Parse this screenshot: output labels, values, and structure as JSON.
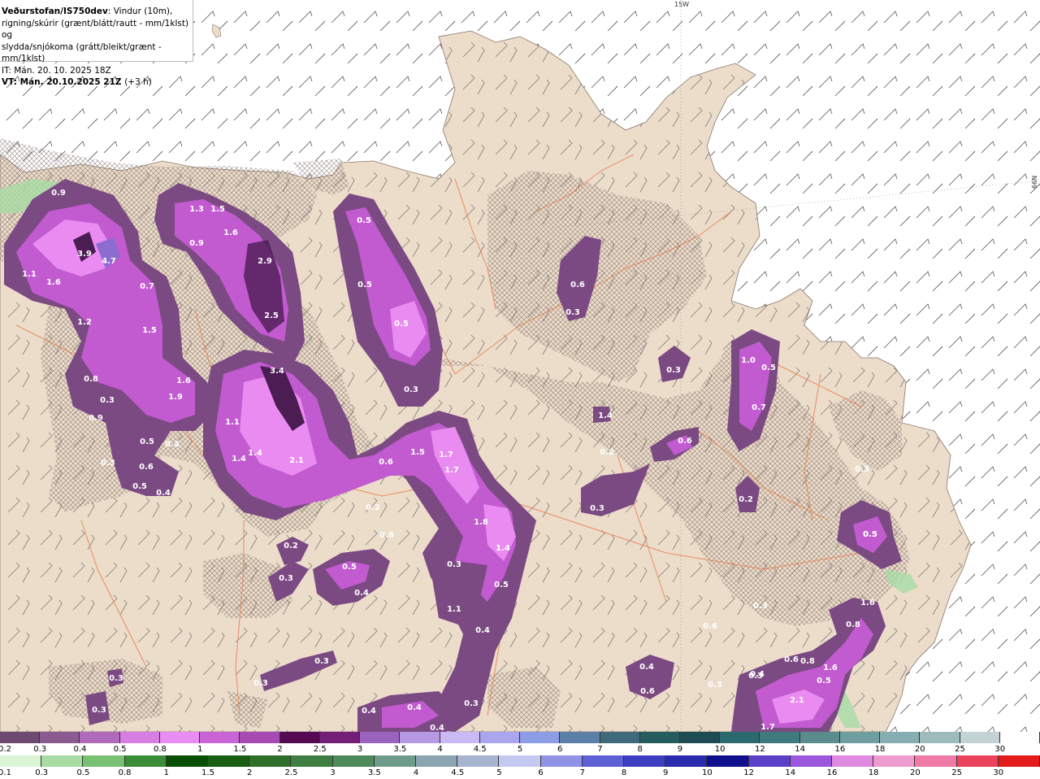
{
  "header": {
    "source_title": "Veðurstofan/IS750dev",
    "description_line1": ": Vindur (10m),",
    "description_line2": "rigning/skúrir (grænt/blátt/rautt - mm/1klst) og",
    "description_line3": "slydda/snjókoma (grátt/bleikt/grænt - mm/1klst)",
    "issue_time": "IT: Mán. 20. 10. 2025 18Z",
    "valid_time": "VT: Mán. 20.10.2025 21Z",
    "lead_time": "(+3 h)"
  },
  "map": {
    "coordinate_labels": {
      "top": "15W",
      "right": "66N"
    },
    "colors": {
      "sea": "#ffffff",
      "land": "#ecdcca",
      "roads": "#e77f50",
      "precip_light": "#7b4a82",
      "precip_mid": "#c25ad0",
      "precip_heavy": "#e98bf0",
      "precip_core": "#4b1d52"
    },
    "precip_labels": [
      "0.9",
      "1.3",
      "1.5",
      "3.9",
      "4.7",
      "1.1",
      "1.6",
      "0.7",
      "1.2",
      "1.5",
      "1.6",
      "2.9",
      "2.5",
      "0.9",
      "1.6",
      "0.5",
      "0.8",
      "0.3",
      "3.4",
      "1.1",
      "1.4",
      "1.4",
      "2.1",
      "1.9",
      "0.9",
      "0.2",
      "0.8",
      "0.5",
      "0.4",
      "0.3",
      "0.6",
      "0.5",
      "0.4",
      "0.3",
      "0.5",
      "0.6",
      "0.3",
      "0.5",
      "0.5",
      "1.0",
      "0.7",
      "1.4",
      "0.3",
      "0.2",
      "0.6",
      "1.5",
      "1.7",
      "1.7",
      "0.6",
      "1.8",
      "1.4",
      "0.3",
      "0.2",
      "0.3",
      "0.2",
      "0.3",
      "0.5",
      "0.4",
      "0.5",
      "0.3",
      "0.5",
      "1.1",
      "0.4",
      "0.6",
      "0.3",
      "0.3",
      "0.3",
      "0.3",
      "0.3",
      "0.4",
      "0.4",
      "0.3",
      "0.4",
      "0.6",
      "0.4",
      "0.5",
      "0.3",
      "0.6",
      "0.8",
      "1.6",
      "0.8",
      "1.6",
      "0.5",
      "2.1",
      "1.7",
      "0.3",
      "0.4"
    ]
  },
  "legend_snow": {
    "values": [
      "0.2",
      "0.3",
      "0.4",
      "0.5",
      "0.8",
      "1",
      "1.5",
      "2",
      "2.5",
      "3",
      "3.5",
      "4",
      "4.5",
      "5",
      "6",
      "7",
      "8",
      "9",
      "10",
      "12",
      "14",
      "16",
      "18",
      "20",
      "25",
      "30"
    ],
    "colors": [
      "#6e4a72",
      "#8a5a90",
      "#b06abb",
      "#d67ee2",
      "#ea8cf5",
      "#c964d6",
      "#a74ab4",
      "#540a52",
      "#731f78",
      "#9a63c0",
      "#b59ae3",
      "#cbb9f5",
      "#a9a6ee",
      "#8c9ce7",
      "#5b7fa6",
      "#3e6a7b",
      "#255c5e",
      "#1d4d52",
      "#2a6a6e",
      "#3f7b7e",
      "#5a8c8e",
      "#6e9ea0",
      "#86adb1",
      "#9ebbbc",
      "#c3d2d4",
      "#ffffff"
    ]
  },
  "legend_rain": {
    "values": [
      "0.1",
      "0.3",
      "0.5",
      "0.8",
      "1",
      "1.5",
      "2",
      "2.5",
      "3",
      "3.5",
      "4",
      "4.5",
      "5",
      "6",
      "7",
      "8",
      "9",
      "10",
      "12",
      "14",
      "16",
      "18",
      "20",
      "25",
      "30"
    ],
    "colors": [
      "#d9f5d6",
      "#a8dca4",
      "#78c072",
      "#3b8c36",
      "#0a4d05",
      "#1a5e14",
      "#2f6f2a",
      "#3f7e43",
      "#4f8a5b",
      "#6f9c8a",
      "#8ba4b2",
      "#a6b4d0",
      "#c5c8f0",
      "#8f92e6",
      "#5e60d6",
      "#3e3ec2",
      "#2a2aae",
      "#10108e",
      "#5a3fc9",
      "#9b58dd",
      "#e08ae0",
      "#f09bd0",
      "#f07aa6",
      "#e9425a",
      "#e31b1b"
    ]
  }
}
